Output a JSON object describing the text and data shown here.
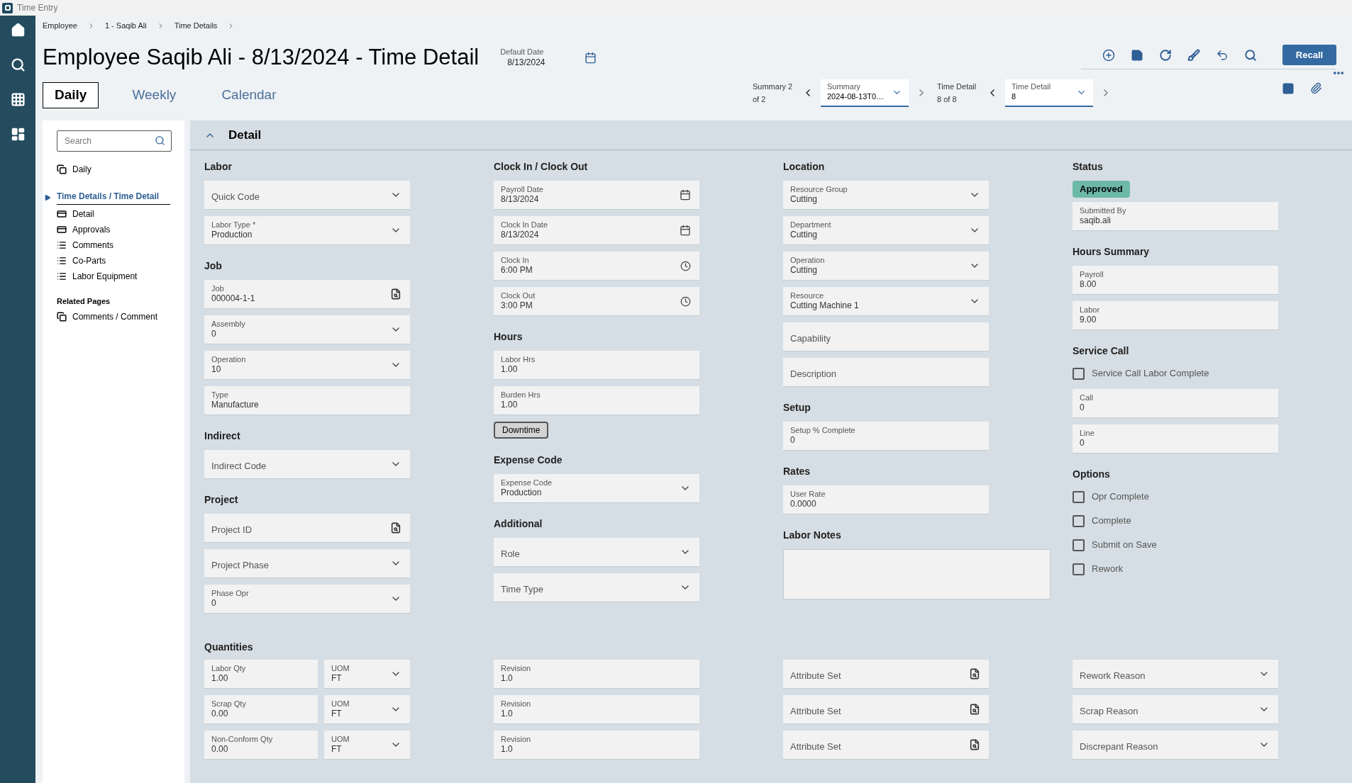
{
  "app": {
    "title": "Time Entry"
  },
  "breadcrumb": [
    "Employee",
    "1 - Saqib Ali",
    "Time Details"
  ],
  "page_title": "Employee Saqib Ali - 8/13/2024 - Time Detail",
  "default_date": {
    "label": "Default Date",
    "value": "8/13/2024"
  },
  "toolbar": {
    "recall": "Recall"
  },
  "view_tabs": [
    {
      "label": "Daily",
      "selected": true
    },
    {
      "label": "Weekly",
      "selected": false
    },
    {
      "label": "Calendar",
      "selected": false
    }
  ],
  "navigators": [
    {
      "caption": "Summary 2 of 2",
      "label": "Summary",
      "value": "2024-08-13T0…"
    },
    {
      "caption": "Time Detail 8 of 8",
      "label": "Time Detail",
      "value": "8"
    }
  ],
  "sidebar": {
    "search": {
      "placeholder": "Search"
    },
    "items": [
      {
        "kind": "page",
        "label": "Daily",
        "selected": false
      },
      {
        "kind": "group",
        "label": "Time Details / Time Detail",
        "selected": true,
        "children": [
          {
            "kind": "card",
            "label": "Detail",
            "selected": false
          },
          {
            "kind": "card",
            "label": "Approvals",
            "selected": false
          },
          {
            "kind": "list",
            "label": "Comments",
            "selected": false
          },
          {
            "kind": "list",
            "label": "Co-Parts",
            "selected": false
          },
          {
            "kind": "list",
            "label": "Labor Equipment",
            "selected": false
          }
        ]
      }
    ],
    "related": {
      "title": "Related Pages",
      "items": [
        {
          "kind": "page",
          "label": "Comments / Comment",
          "selected": false
        }
      ]
    }
  },
  "panel": {
    "title": "Detail",
    "expanded": true,
    "columns": [
      [
        {
          "title": "Labor",
          "items": [
            {
              "kind": "select",
              "label": "Quick Code"
            },
            {
              "kind": "select",
              "label": "Labor Type *",
              "value": "Production"
            }
          ]
        },
        {
          "title": "Job",
          "items": [
            {
              "kind": "lookup",
              "label": "Job",
              "value": "000004-1-1"
            },
            {
              "kind": "select",
              "label": "Assembly",
              "value": "0"
            },
            {
              "kind": "select",
              "label": "Operation",
              "value": "10"
            },
            {
              "kind": "text",
              "label": "Type",
              "value": "Manufacture"
            }
          ]
        },
        {
          "title": "Indirect",
          "items": [
            {
              "kind": "select",
              "label": "Indirect Code"
            }
          ]
        },
        {
          "title": "Project",
          "items": [
            {
              "kind": "lookup",
              "label": "Project ID"
            },
            {
              "kind": "select",
              "label": "Project Phase"
            },
            {
              "kind": "select",
              "label": "Phase Opr",
              "value": "0"
            }
          ]
        }
      ],
      [
        {
          "title": "Clock In / Clock Out",
          "items": [
            {
              "kind": "date",
              "label": "Payroll Date",
              "value": "8/13/2024"
            },
            {
              "kind": "date",
              "label": "Clock In Date",
              "value": "8/13/2024"
            },
            {
              "kind": "time",
              "label": "Clock In",
              "value": "6:00 PM"
            },
            {
              "kind": "time",
              "label": "Clock Out",
              "value": "3:00 PM"
            }
          ]
        },
        {
          "title": "Hours",
          "items": [
            {
              "kind": "text",
              "label": "Labor Hrs",
              "value": "1.00"
            },
            {
              "kind": "text",
              "label": "Burden Hrs",
              "value": "1.00"
            },
            {
              "kind": "button",
              "label": "Downtime"
            }
          ]
        },
        {
          "title": "Expense Code",
          "items": [
            {
              "kind": "select",
              "label": "Expense Code",
              "value": "Production"
            }
          ]
        },
        {
          "title": "Additional",
          "items": [
            {
              "kind": "select",
              "label": "Role"
            },
            {
              "kind": "select",
              "label": "Time Type"
            }
          ]
        }
      ],
      [
        {
          "title": "Location",
          "items": [
            {
              "kind": "select",
              "label": "Resource Group",
              "value": "Cutting"
            },
            {
              "kind": "select",
              "label": "Department",
              "value": "Cutting"
            },
            {
              "kind": "select",
              "label": "Operation",
              "value": "Cutting"
            },
            {
              "kind": "select",
              "label": "Resource",
              "value": "Cutting Machine 1"
            },
            {
              "kind": "text",
              "label": "Capability"
            },
            {
              "kind": "text",
              "label": "Description"
            }
          ]
        },
        {
          "title": "Setup",
          "items": [
            {
              "kind": "text",
              "label": "Setup % Complete",
              "value": "0"
            }
          ]
        },
        {
          "title": "Rates",
          "items": [
            {
              "kind": "text",
              "label": "User Rate",
              "value": "0.0000"
            }
          ]
        },
        {
          "title": "Labor Notes",
          "items": [
            {
              "kind": "textarea"
            }
          ]
        }
      ],
      [
        {
          "title": "Status",
          "items": [
            {
              "kind": "badge",
              "label": "Approved",
              "color": "#6db9a8"
            },
            {
              "kind": "text",
              "label": "Submitted By",
              "value": "saqib.ali"
            }
          ]
        },
        {
          "title": "Hours Summary",
          "items": [
            {
              "kind": "text",
              "label": "Payroll",
              "value": "8.00"
            },
            {
              "kind": "text",
              "label": "Labor",
              "value": "9.00"
            }
          ]
        },
        {
          "title": "Service Call",
          "items": [
            {
              "kind": "checkbox",
              "label": "Service Call Labor Complete",
              "checked": false
            },
            {
              "kind": "text",
              "label": "Call",
              "value": "0"
            },
            {
              "kind": "text",
              "label": "Line",
              "value": "0"
            }
          ]
        },
        {
          "title": "Options",
          "items": [
            {
              "kind": "checkbox",
              "label": "Opr Complete",
              "checked": false
            },
            {
              "kind": "checkbox",
              "label": "Complete",
              "checked": false
            },
            {
              "kind": "checkbox",
              "label": "Submit on Save",
              "checked": false
            },
            {
              "kind": "checkbox",
              "label": "Rework",
              "checked": false
            }
          ]
        }
      ]
    ],
    "quantities": {
      "title": "Quantities",
      "rows": [
        {
          "qty": {
            "label": "Labor Qty",
            "value": "1.00"
          },
          "uom": {
            "label": "UOM",
            "value": "FT"
          },
          "revision": {
            "label": "Revision",
            "value": "1.0"
          },
          "attribute_set": "Attribute Set",
          "reason": "Rework Reason"
        },
        {
          "qty": {
            "label": "Scrap Qty",
            "value": "0.00"
          },
          "uom": {
            "label": "UOM",
            "value": "FT"
          },
          "revision": {
            "label": "Revision",
            "value": "1.0"
          },
          "attribute_set": "Attribute Set",
          "reason": "Scrap Reason"
        },
        {
          "qty": {
            "label": "Non-Conform Qty",
            "value": "0.00"
          },
          "uom": {
            "label": "UOM",
            "value": "FT"
          },
          "revision": {
            "label": "Revision",
            "value": "1.0"
          },
          "attribute_set": "Attribute Set",
          "reason": "Discrepant Reason"
        }
      ]
    }
  }
}
